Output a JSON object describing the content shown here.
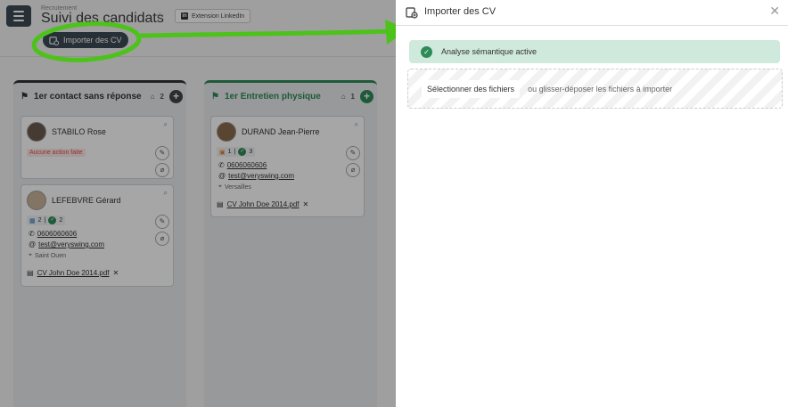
{
  "app": {
    "breadcrumb": "Recrutement",
    "title": "Suivi des candidats",
    "linkedin_button": "Extension LinkedIn",
    "import_button": "Importer des CV"
  },
  "columns": [
    {
      "title": "1er contact sans réponse",
      "count": "2",
      "cards": [
        {
          "name": "STABILO Rose",
          "status": "Aucune action faite"
        },
        {
          "name": "LEFEBVRE Gérard",
          "stat_a": "2",
          "stat_b": "2",
          "phone": "0606060606",
          "email": "test@veryswing.com",
          "city": "Saint Ouen",
          "cv": "CV John Doe 2014.pdf"
        }
      ]
    },
    {
      "title": "1er Entretien physique",
      "count": "1",
      "cards": [
        {
          "name": "DURAND Jean-Pierre",
          "stat_a": "1",
          "stat_b": "3",
          "phone": "0606060606",
          "email": "test@veryswing.com",
          "city": "Versailles",
          "cv": "CV John Doe 2014.pdf"
        }
      ]
    }
  ],
  "panel": {
    "title": "Importer des CV",
    "alert": "Analyse sémantique active",
    "select_button": "Sélectionner des fichiers",
    "drop_text": "ou glisser-déposer les fichiers à importer"
  },
  "colors": {
    "accent_green": "#2e8b57",
    "annotation_green": "#4cc21a",
    "dark": "#3d4a54"
  }
}
